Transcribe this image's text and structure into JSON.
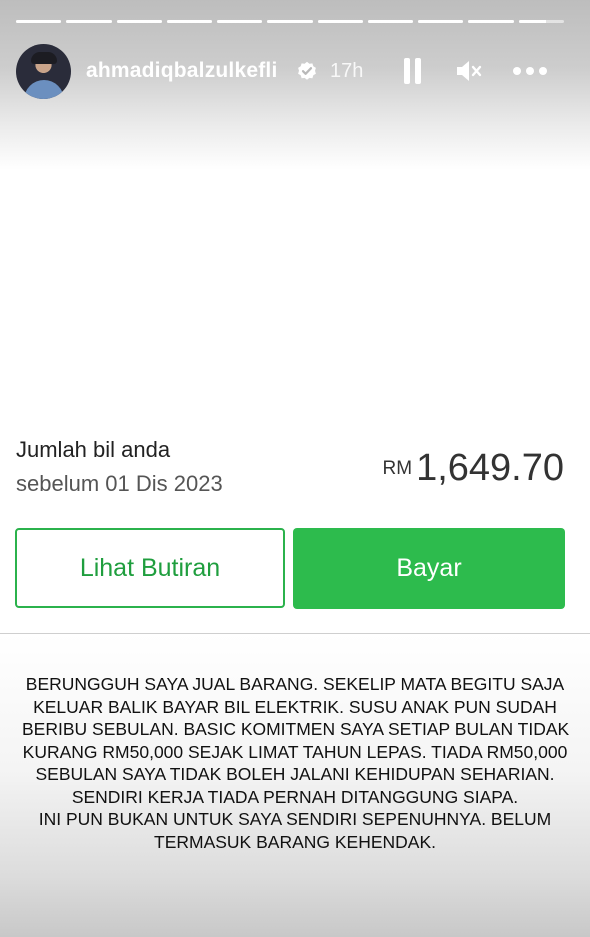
{
  "story": {
    "segments": 11,
    "current_segment": 11,
    "current_progress": 0.6
  },
  "header": {
    "username": "ahmadiqbalzulkefli",
    "verified": true,
    "time_ago": "17h",
    "icons": [
      "pause-icon",
      "mute-icon",
      "more-icon"
    ]
  },
  "bill": {
    "title": "Jumlah bil anda",
    "due_text": "sebelum 01 Dis 2023",
    "currency": "RM",
    "amount": "1,649.70",
    "details_button": "Lihat Butiran",
    "pay_button": "Bayar",
    "accent_color": "#2dbb4d"
  },
  "caption": {
    "lines": [
      "BERUNGGUH SAYA JUAL BARANG. SEKELIP MATA BEGITU SAJA",
      "KELUAR BALIK BAYAR BIL ELEKTRIK. SUSU ANAK PUN SUDAH",
      "BERIBU SEBULAN. BASIC KOMITMEN SAYA SETIAP BULAN TIDAK",
      "KURANG RM50,000 SEJAK LIMAT TAHUN LEPAS. TIADA RM50,000",
      "SEBULAN SAYA TIDAK BOLEH JALANI KEHIDUPAN SEHARIAN.",
      "SENDIRI KERJA TIADA PERNAH DITANGGUNG SIAPA.",
      "INI PUN BUKAN UNTUK SAYA SENDIRI SEPENUHNYA. BELUM",
      "TERMASUK BARANG KEHENDAK."
    ]
  }
}
